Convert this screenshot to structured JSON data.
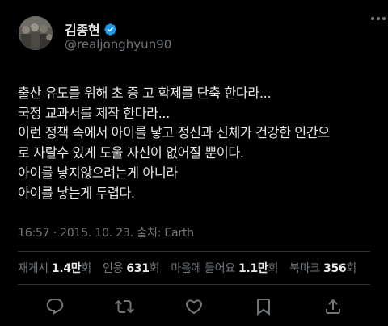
{
  "author": {
    "display_name": "김종현",
    "handle": "@realjonghyun90",
    "verified_color": "#1d9bf0"
  },
  "tweet": {
    "lines": [
      "출산 유도를 위해 초 중 고 학제를 단축 한다라...",
      "국정 교과서를 제작 한다라...",
      "이런 정책 속에서 아이를 낳고 정신과 신체가 건강한 인간으",
      "로 자랄수 있게 도울 자신이 없어질 뿐이다.",
      "아이를 낳지않으려는게 아니라",
      "아이를 낳는게 두렵다."
    ],
    "meta": "16:57 · 2015. 10. 23. 출처: Earth"
  },
  "stats": [
    {
      "label": "재게시",
      "count": "1.4만",
      "suffix": "회"
    },
    {
      "label": "인용",
      "count": "631",
      "suffix": "회"
    },
    {
      "label": "마음에 들어요",
      "count": "1.1만",
      "suffix": "회"
    },
    {
      "label": "북마크",
      "count": "356",
      "suffix": "회"
    }
  ],
  "icons": {
    "more": "more-horizontal-icon",
    "reply": "reply-icon",
    "retweet": "retweet-icon",
    "like": "heart-icon",
    "bookmark": "bookmark-icon",
    "share": "share-icon"
  },
  "colors": {
    "background": "#000000",
    "text": "#e7e9ea",
    "secondary": "#71767b",
    "accent": "#1d9bf0"
  }
}
